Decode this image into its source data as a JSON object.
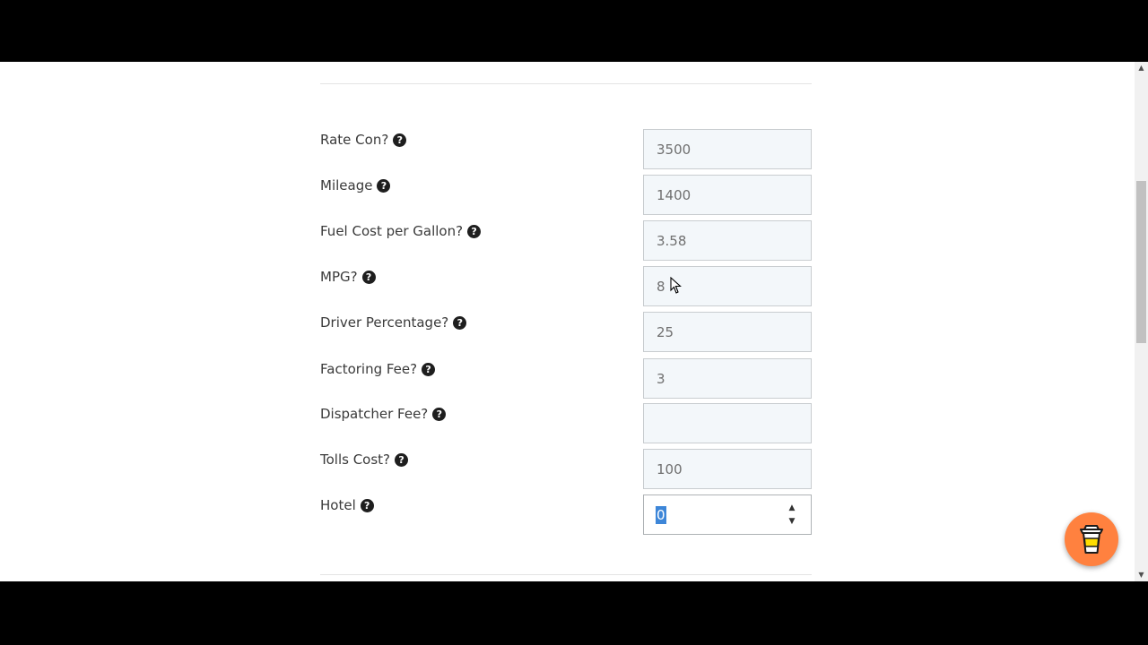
{
  "form": {
    "fields": [
      {
        "label": "Rate Con?",
        "value": "3500",
        "placeholder": ""
      },
      {
        "label": "Mileage",
        "value": "1400",
        "placeholder": ""
      },
      {
        "label": "Fuel Cost per Gallon?",
        "value": "3.58",
        "placeholder": ""
      },
      {
        "label": "MPG?",
        "value": "8",
        "placeholder": ""
      },
      {
        "label": "Driver Percentage?",
        "value": "25",
        "placeholder": ""
      },
      {
        "label": "Factoring Fee?",
        "value": "3",
        "placeholder": ""
      },
      {
        "label": "Dispatcher Fee?",
        "value": "",
        "placeholder": ""
      },
      {
        "label": "Tolls Cost?",
        "value": "100",
        "placeholder": ""
      },
      {
        "label": "Hotel",
        "value": "0",
        "placeholder": ""
      }
    ],
    "help_glyph": "?"
  },
  "widgets": {
    "coffee_button_icon": "coffee-cup-icon",
    "coffee_button_color": "#ff813f"
  },
  "colors": {
    "field_background": "#f3f7fa",
    "selection": "#3d86d8"
  }
}
